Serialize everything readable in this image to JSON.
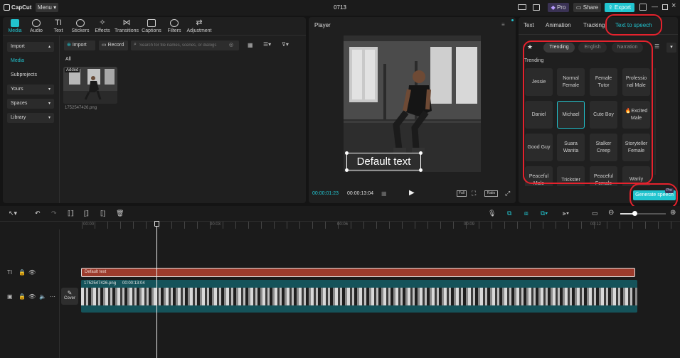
{
  "app": {
    "name": "CapCut",
    "menu_label": "Menu",
    "project_name": "0713"
  },
  "titlebar": {
    "pro_label": "Pro",
    "share_label": "Share",
    "export_label": "Export"
  },
  "toolbar": {
    "items": [
      {
        "label": "Media",
        "icon": "media-icon"
      },
      {
        "label": "Audio",
        "icon": "audio-icon"
      },
      {
        "label": "Text",
        "icon": "text-icon"
      },
      {
        "label": "Stickers",
        "icon": "stickers-icon"
      },
      {
        "label": "Effects",
        "icon": "effects-icon"
      },
      {
        "label": "Transitions",
        "icon": "transitions-icon"
      },
      {
        "label": "Captions",
        "icon": "captions-icon"
      },
      {
        "label": "Filters",
        "icon": "filters-icon"
      },
      {
        "label": "Adjustment",
        "icon": "adjustment-icon"
      }
    ]
  },
  "sidebar": {
    "items": [
      {
        "label": "Import"
      },
      {
        "label": "Media"
      },
      {
        "label": "Subprojects"
      },
      {
        "label": "Yours"
      },
      {
        "label": "Spaces"
      },
      {
        "label": "Library"
      }
    ]
  },
  "media": {
    "import_label": "Import",
    "record_label": "Record",
    "search_placeholder": "Search for file names, scenes, or dialogs",
    "filter_label": "All",
    "item": {
      "badge": "Added",
      "filename": "1752547426.png"
    }
  },
  "player": {
    "title": "Player",
    "overlay_text": "Default text",
    "current_time": "00:00:01:23",
    "total_time": "00:00:13:04",
    "full_label": "Full",
    "ratio_label": "Ratio"
  },
  "right_panel": {
    "tabs": [
      "Text",
      "Animation",
      "Tracking",
      "Text to speech"
    ],
    "filters": [
      "Trending",
      "English",
      "Narration"
    ],
    "section_label": "Trending",
    "voices": [
      "Jessie",
      "Normal Female",
      "Female Tutor",
      "Professio nal Male",
      "Daniel",
      "Michael",
      "Cute Boy",
      "Excited Male",
      "Good Guy",
      "Suara Wanita",
      "Stalker Creep",
      "Storyteller Female",
      "Peaceful Male",
      "Trickster",
      "Peaceful Female",
      "Wanly"
    ],
    "generate_label": "Generate speech",
    "generate_badge": "Pro"
  },
  "timeline": {
    "ticks": [
      "00:00",
      "00:03",
      "00:06",
      "00:09",
      "00:12"
    ],
    "text_clip_label": "Default text",
    "video_clip_name": "1752547426.png",
    "video_clip_duration": "00:00:13:04",
    "cover_label": "Cover"
  },
  "colors": {
    "accent": "#21c4cf",
    "text_clip": "#9c3b2c",
    "video_clip": "#15535a",
    "highlight": "#e5222d"
  }
}
